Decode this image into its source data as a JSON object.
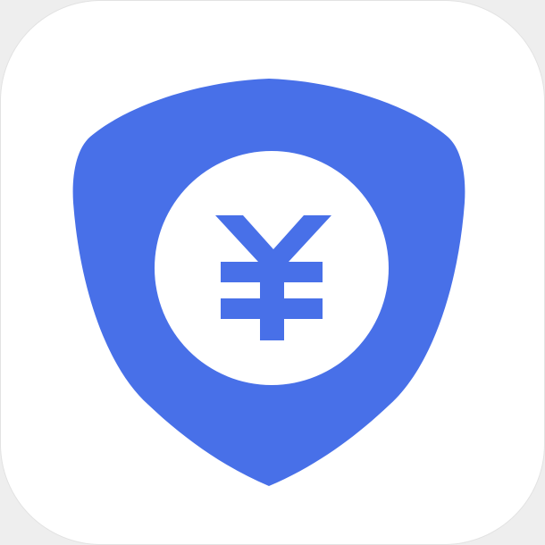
{
  "icon": {
    "name": "shield-yen-icon",
    "glyph": "yen-icon",
    "colors": {
      "tile": "#ffffff",
      "shield": "#4870e8",
      "coin": "#ffffff",
      "glyph": "#4870e8"
    }
  }
}
